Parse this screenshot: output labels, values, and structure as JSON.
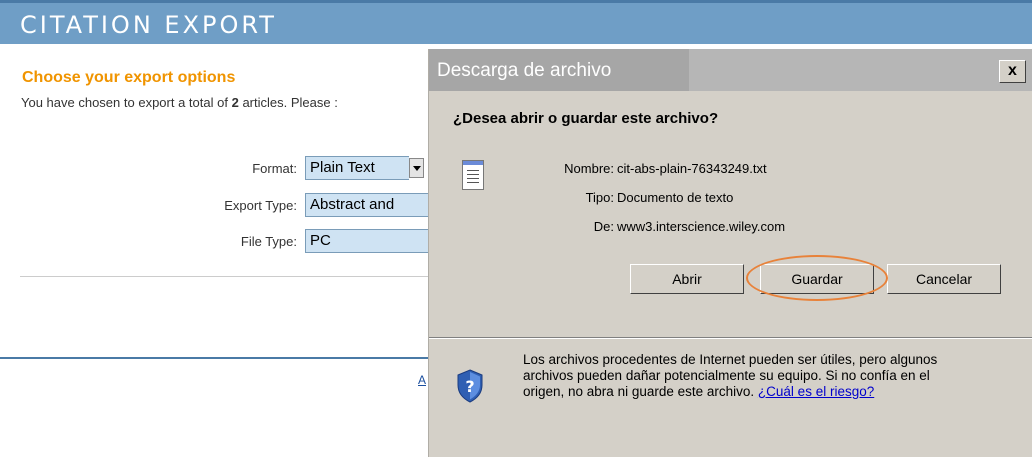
{
  "page": {
    "header_title": "CITATION EXPORT",
    "section_title": "Choose your export options",
    "intro_text": "You have chosen to export a total of",
    "intro_count": "2",
    "intro_suffix": "articles. Please :",
    "fields": {
      "format": {
        "label": "Format:",
        "value": "Plain Text"
      },
      "export_type": {
        "label": "Export Type:",
        "value": "Abstract and"
      },
      "file_type": {
        "label": "File Type:",
        "value": "PC"
      }
    },
    "cut_link": "A"
  },
  "dialog": {
    "title": "Descarga de archivo",
    "close_label": "x",
    "question": "¿Desea abrir o guardar este archivo?",
    "name_label": "Nombre:",
    "name_value": "cit-abs-plain-76343249.txt",
    "type_label": "Tipo:",
    "type_value": "Documento de texto",
    "from_label": "De:",
    "from_value": "www3.interscience.wiley.com",
    "buttons": {
      "open": "Abrir",
      "save": "Guardar",
      "cancel": "Cancelar"
    },
    "warning_text": "Los archivos procedentes de Internet pueden ser útiles, pero algunos archivos pueden dañar potencialmente su equipo. Si no confía en el origen, no abra ni guarde este archivo.",
    "risk_link": "¿Cuál es el riesgo?"
  },
  "colors": {
    "header_bg": "#6f9ec6",
    "section_title": "#f09400",
    "field_bg": "#cfe3f3",
    "dialog_bg": "#d4d0c8",
    "highlight_ring": "#e8823a"
  },
  "icons": [
    "text-file-icon",
    "shield-question-icon",
    "dropdown-arrow-icon",
    "close-icon"
  ]
}
